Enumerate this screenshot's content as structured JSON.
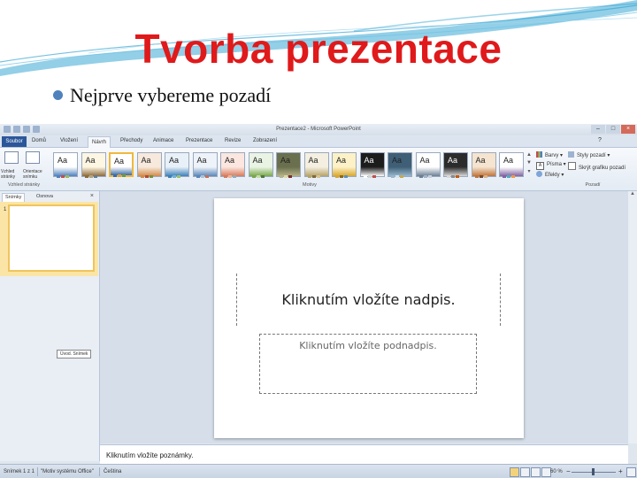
{
  "slide": {
    "title": "Tvorba prezentace",
    "bullet": "Nejprve vybereme pozadí",
    "colors": {
      "title": "#e0191b",
      "bullet_dot": "#4f81bd",
      "swoosh": "#3aa7d4"
    }
  },
  "app": {
    "window_title": "Prezentace2 - Microsoft PowerPoint",
    "tabs": [
      "Soubor",
      "Domů",
      "Vložení",
      "Návrh",
      "Přechody",
      "Animace",
      "Prezentace",
      "Revize",
      "Zobrazení"
    ],
    "active_tab": "Návrh",
    "ribbon": {
      "page_setup_buttons": [
        "Vzhled stránky",
        "Orientace snímku"
      ],
      "page_setup_group": "Vzhled stránky",
      "themes_group": "Motivy",
      "theme_sample": "Aa",
      "theme_count": 17,
      "background_group": "Pozadí",
      "colors_label": "Barvy",
      "fonts_label": "Písma",
      "effects_label": "Efekty",
      "bg_styles_label": "Styly pozadí",
      "hide_bg_label": "Skrýt grafiku pozadí"
    },
    "left_pane": {
      "tabs": [
        "Snímky",
        "Osnova"
      ],
      "slide_number": "1",
      "tooltip": "Úvod. Snímek"
    },
    "placeholders": {
      "title": "Kliknutím vložíte nadpis.",
      "subtitle": "Kliknutím vložíte podnadpis."
    },
    "notes": "Kliknutím vložíte poznámky.",
    "status": {
      "slide_info": "Snímek 1 z 1",
      "theme": "\"Motiv systému Office\"",
      "language": "Čeština",
      "zoom": "60 %"
    }
  }
}
